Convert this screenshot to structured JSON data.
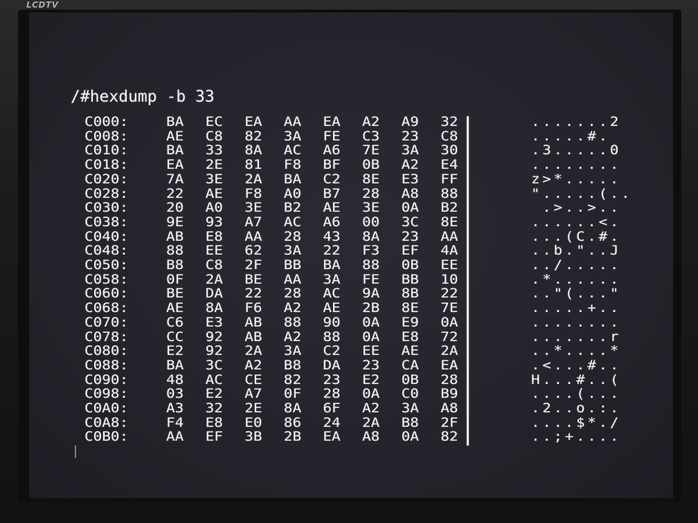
{
  "monitor": {
    "brand": "LCDTV"
  },
  "terminal": {
    "prompt": "/#hexdump -b 33",
    "rows": [
      {
        "addr": "C000:",
        "bytes": [
          "BA",
          "EC",
          "EA",
          "AA",
          "EA",
          "A2",
          "A9",
          "32"
        ],
        "ascii": ".......2"
      },
      {
        "addr": "C008:",
        "bytes": [
          "AE",
          "C8",
          "82",
          "3A",
          "FE",
          "C3",
          "23",
          "C8"
        ],
        "ascii": ".....#."
      },
      {
        "addr": "C010:",
        "bytes": [
          "BA",
          "33",
          "8A",
          "AC",
          "A6",
          "7E",
          "3A",
          "30"
        ],
        "ascii": ".3.....0"
      },
      {
        "addr": "C018:",
        "bytes": [
          "EA",
          "2E",
          "81",
          "F8",
          "BF",
          "0B",
          "A2",
          "E4"
        ],
        "ascii": "........"
      },
      {
        "addr": "C020:",
        "bytes": [
          "7A",
          "3E",
          "2A",
          "BA",
          "C2",
          "8E",
          "E3",
          "FF"
        ],
        "ascii": "z>*....."
      },
      {
        "addr": "C028:",
        "bytes": [
          "22",
          "AE",
          "F8",
          "A0",
          "B7",
          "28",
          "A8",
          "88"
        ],
        "ascii": "\".....(.."
      },
      {
        "addr": "C030:",
        "bytes": [
          "20",
          "A0",
          "3E",
          "B2",
          "AE",
          "3E",
          "0A",
          "B2"
        ],
        "ascii": " .>..>.."
      },
      {
        "addr": "C038:",
        "bytes": [
          "9E",
          "93",
          "A7",
          "AC",
          "A6",
          "00",
          "3C",
          "8E"
        ],
        "ascii": "......<."
      },
      {
        "addr": "C040:",
        "bytes": [
          "AB",
          "E8",
          "AA",
          "28",
          "43",
          "8A",
          "23",
          "AA"
        ],
        "ascii": "...(C.#."
      },
      {
        "addr": "C048:",
        "bytes": [
          "88",
          "EE",
          "62",
          "3A",
          "22",
          "F3",
          "EF",
          "4A"
        ],
        "ascii": "..b.\"..J"
      },
      {
        "addr": "C050:",
        "bytes": [
          "B8",
          "C8",
          "2F",
          "BB",
          "BA",
          "88",
          "0B",
          "EE"
        ],
        "ascii": "../....."
      },
      {
        "addr": "C058:",
        "bytes": [
          "0F",
          "2A",
          "BE",
          "AA",
          "3A",
          "FE",
          "BB",
          "10"
        ],
        "ascii": ".*......"
      },
      {
        "addr": "C060:",
        "bytes": [
          "BE",
          "DA",
          "22",
          "28",
          "AC",
          "9A",
          "8B",
          "22"
        ],
        "ascii": "..\"(...\""
      },
      {
        "addr": "C068:",
        "bytes": [
          "AE",
          "8A",
          "F6",
          "A2",
          "AE",
          "2B",
          "8E",
          "7E"
        ],
        "ascii": ".....+.."
      },
      {
        "addr": "C070:",
        "bytes": [
          "C6",
          "E3",
          "AB",
          "88",
          "90",
          "0A",
          "E9",
          "0A"
        ],
        "ascii": "........"
      },
      {
        "addr": "C078:",
        "bytes": [
          "CC",
          "92",
          "AB",
          "A2",
          "88",
          "0A",
          "E8",
          "72"
        ],
        "ascii": ".......r"
      },
      {
        "addr": "C080:",
        "bytes": [
          "E2",
          "92",
          "2A",
          "3A",
          "C2",
          "EE",
          "AE",
          "2A"
        ],
        "ascii": "..*....*"
      },
      {
        "addr": "C088:",
        "bytes": [
          "BA",
          "3C",
          "A2",
          "B8",
          "DA",
          "23",
          "CA",
          "EA"
        ],
        "ascii": ".<...#.."
      },
      {
        "addr": "C090:",
        "bytes": [
          "48",
          "AC",
          "CE",
          "82",
          "23",
          "E2",
          "0B",
          "28"
        ],
        "ascii": "H...#..("
      },
      {
        "addr": "C098:",
        "bytes": [
          "03",
          "E2",
          "A7",
          "0F",
          "28",
          "0A",
          "C0",
          "B9"
        ],
        "ascii": "....(..."
      },
      {
        "addr": "C0A0:",
        "bytes": [
          "A3",
          "32",
          "2E",
          "8A",
          "6F",
          "A2",
          "3A",
          "A8"
        ],
        "ascii": ".2..o.:."
      },
      {
        "addr": "C0A8:",
        "bytes": [
          "F4",
          "E8",
          "E0",
          "86",
          "24",
          "2A",
          "B8",
          "2F"
        ],
        "ascii": "....$*./"
      },
      {
        "addr": "C0B0:",
        "bytes": [
          "AA",
          "EF",
          "3B",
          "2B",
          "EA",
          "A8",
          "0A",
          "82"
        ],
        "ascii": "..;+...."
      }
    ]
  },
  "colors": {
    "screen_bg": "#26262e",
    "text": "#f2f2f2",
    "bezel": "#0e0e0e"
  }
}
